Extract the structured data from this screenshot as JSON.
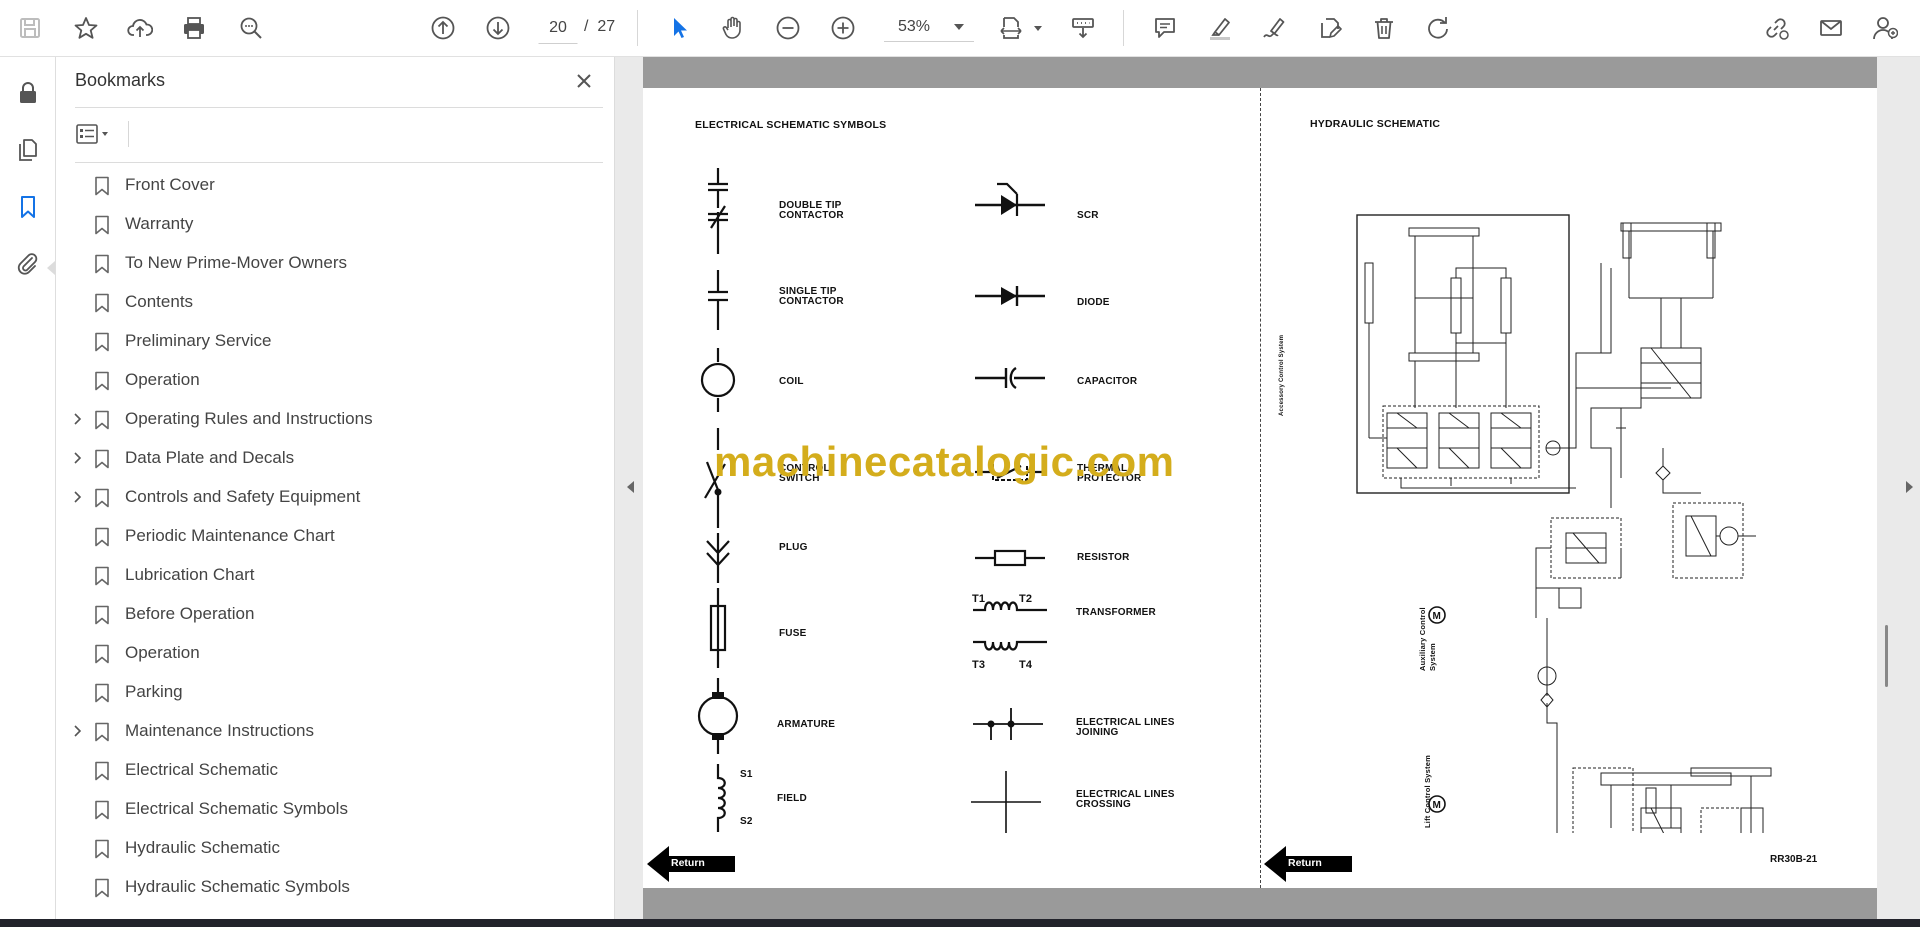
{
  "toolbar": {
    "current_page": "20",
    "page_separator": "/",
    "total_pages": "27",
    "zoom": "53%"
  },
  "bookmarks": {
    "title": "Bookmarks",
    "items": [
      {
        "label": "Front Cover",
        "expandable": false
      },
      {
        "label": "Warranty",
        "expandable": false
      },
      {
        "label": "To New Prime-Mover Owners",
        "expandable": false
      },
      {
        "label": "Contents",
        "expandable": false
      },
      {
        "label": "Preliminary Service",
        "expandable": false
      },
      {
        "label": "Operation",
        "expandable": false
      },
      {
        "label": "Operating Rules and Instructions",
        "expandable": true
      },
      {
        "label": "Data Plate and Decals",
        "expandable": true
      },
      {
        "label": "Controls and Safety Equipment",
        "expandable": true
      },
      {
        "label": "Periodic Maintenance Chart",
        "expandable": false
      },
      {
        "label": "Lubrication Chart",
        "expandable": false
      },
      {
        "label": "Before Operation",
        "expandable": false
      },
      {
        "label": "Operation",
        "expandable": false
      },
      {
        "label": "Parking",
        "expandable": false
      },
      {
        "label": "Maintenance Instructions",
        "expandable": true
      },
      {
        "label": "Electrical Schematic",
        "expandable": false
      },
      {
        "label": "Electrical Schematic Symbols",
        "expandable": false
      },
      {
        "label": "Hydraulic Schematic",
        "expandable": false
      },
      {
        "label": "Hydraulic Schematic Symbols",
        "expandable": false
      }
    ]
  },
  "document": {
    "left_heading": "ELECTRICAL SCHEMATIC SYMBOLS",
    "right_heading": "HYDRAULIC SCHEMATIC",
    "symbols_left": [
      "DOUBLE TIP\nCONTACTOR",
      "SINGLE TIP\nCONTACTOR",
      "COIL",
      "CONTROL\nSWITCH",
      "PLUG",
      "FUSE",
      "ARMATURE",
      "FIELD"
    ],
    "symbols_right": [
      "SCR",
      "DIODE",
      "CAPACITOR",
      "THERMAL\nPROTECTOR",
      "RESISTOR",
      "TRANSFORMER",
      "ELECTRICAL LINES\nJOINING",
      "ELECTRICAL LINES\nCROSSING"
    ],
    "transformer_terminals": [
      "T1",
      "T2",
      "T3",
      "T4"
    ],
    "field_terminals": [
      "S1",
      "S2"
    ],
    "return_label": "Return",
    "hydraulic_labels": {
      "accessory": "Accessory Control System",
      "auxiliary": "Auxiliary Control System",
      "lift": "Lift Control System"
    },
    "figure_number": "RR30B-21",
    "watermark": "machinecatalogic.com"
  }
}
